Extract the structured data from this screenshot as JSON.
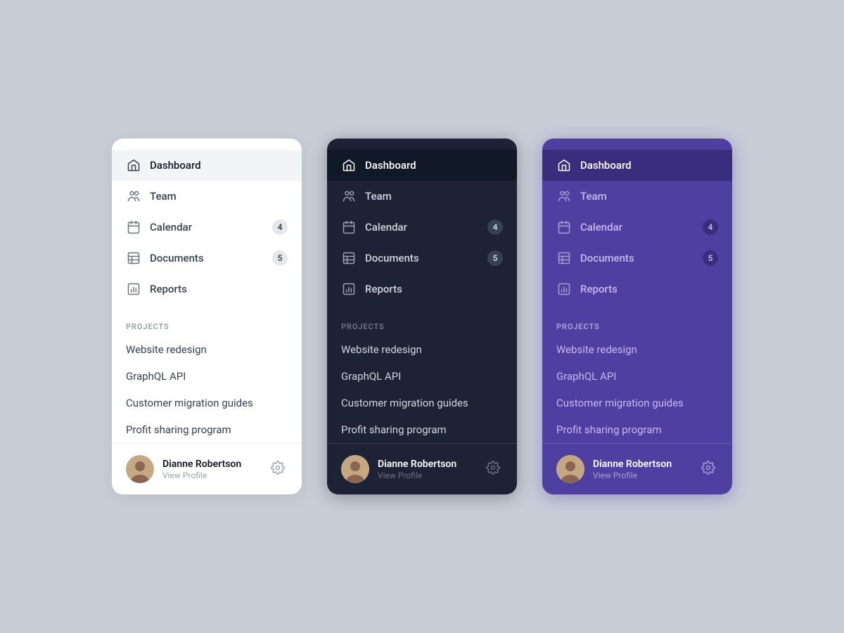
{
  "page": {
    "bg": "#c8cdd8"
  },
  "nav": {
    "items": [
      {
        "id": "dashboard",
        "label": "Dashboard",
        "icon": "home"
      },
      {
        "id": "team",
        "label": "Team",
        "icon": "team"
      },
      {
        "id": "calendar",
        "label": "Calendar",
        "icon": "calendar",
        "badge": "4"
      },
      {
        "id": "documents",
        "label": "Documents",
        "icon": "documents",
        "badge": "5"
      },
      {
        "id": "reports",
        "label": "Reports",
        "icon": "reports"
      }
    ],
    "projects_label": "PROJECTS",
    "projects": [
      "Website redesign",
      "GraphQL API",
      "Customer migration guides",
      "Profit sharing program"
    ]
  },
  "user": {
    "name": "Dianne Robertson",
    "sub": "View Profile"
  },
  "sidebars": [
    {
      "theme": "light",
      "active": "dashboard"
    },
    {
      "theme": "dark",
      "active": "dashboard"
    },
    {
      "theme": "purple",
      "active": "dashboard"
    }
  ]
}
